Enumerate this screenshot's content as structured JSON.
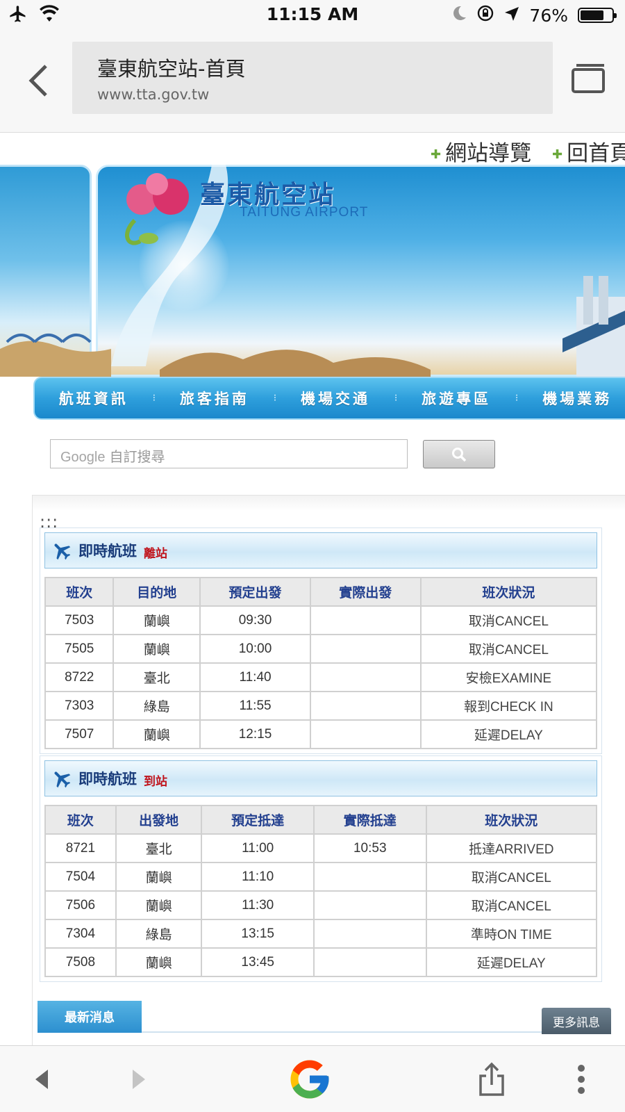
{
  "status_bar": {
    "time": "11:15 AM",
    "battery_percent_label": "76%",
    "battery_level": 0.76,
    "icons": [
      "airplane-mode-icon",
      "wifi-icon",
      "moon-icon",
      "rotation-lock-icon",
      "location-arrow-icon",
      "battery-icon"
    ]
  },
  "browser": {
    "page_title": "臺東航空站-首頁",
    "url": "www.tta.gov.tw"
  },
  "top_links": [
    {
      "label": "網站導覽"
    },
    {
      "label": "回首頁"
    }
  ],
  "banner": {
    "site_name": "臺東航空站",
    "site_name_en": "TAITUNG AIRPORT"
  },
  "nav": {
    "items": [
      {
        "label": "航班資訊"
      },
      {
        "label": "旅客指南"
      },
      {
        "label": "機場交通"
      },
      {
        "label": "旅遊專區"
      },
      {
        "label": "機場業務"
      }
    ]
  },
  "search": {
    "brand": "Google",
    "placeholder": "自訂搜尋"
  },
  "content": {
    "breadcrumb_dots": ":::"
  },
  "departures": {
    "title": "即時航班",
    "subtitle": "離站",
    "columns": [
      "班次",
      "目的地",
      "預定出發",
      "實際出發",
      "班次狀況"
    ],
    "rows": [
      [
        "7503",
        "蘭嶼",
        "09:30",
        "",
        "取消CANCEL"
      ],
      [
        "7505",
        "蘭嶼",
        "10:00",
        "",
        "取消CANCEL"
      ],
      [
        "8722",
        "臺北",
        "11:40",
        "",
        "安檢EXAMINE"
      ],
      [
        "7303",
        "綠島",
        "11:55",
        "",
        "報到CHECK IN"
      ],
      [
        "7507",
        "蘭嶼",
        "12:15",
        "",
        "延遲DELAY"
      ]
    ]
  },
  "arrivals": {
    "title": "即時航班",
    "subtitle": "到站",
    "columns": [
      "班次",
      "出發地",
      "預定抵達",
      "實際抵達",
      "班次狀況"
    ],
    "rows": [
      [
        "8721",
        "臺北",
        "11:00",
        "10:53",
        "抵達ARRIVED"
      ],
      [
        "7504",
        "蘭嶼",
        "11:10",
        "",
        "取消CANCEL"
      ],
      [
        "7506",
        "蘭嶼",
        "11:30",
        "",
        "取消CANCEL"
      ],
      [
        "7304",
        "綠島",
        "13:15",
        "",
        "準時ON TIME"
      ],
      [
        "7508",
        "蘭嶼",
        "13:45",
        "",
        "延遲DELAY"
      ]
    ]
  },
  "news": {
    "tab_label": "最新消息",
    "more_label": "更多訊息"
  },
  "colors": {
    "nav_blue": "#2e9fdc",
    "header_text": "#1a3c7a",
    "subtitle_red": "#c0151d",
    "table_header_text": "#23408f"
  }
}
